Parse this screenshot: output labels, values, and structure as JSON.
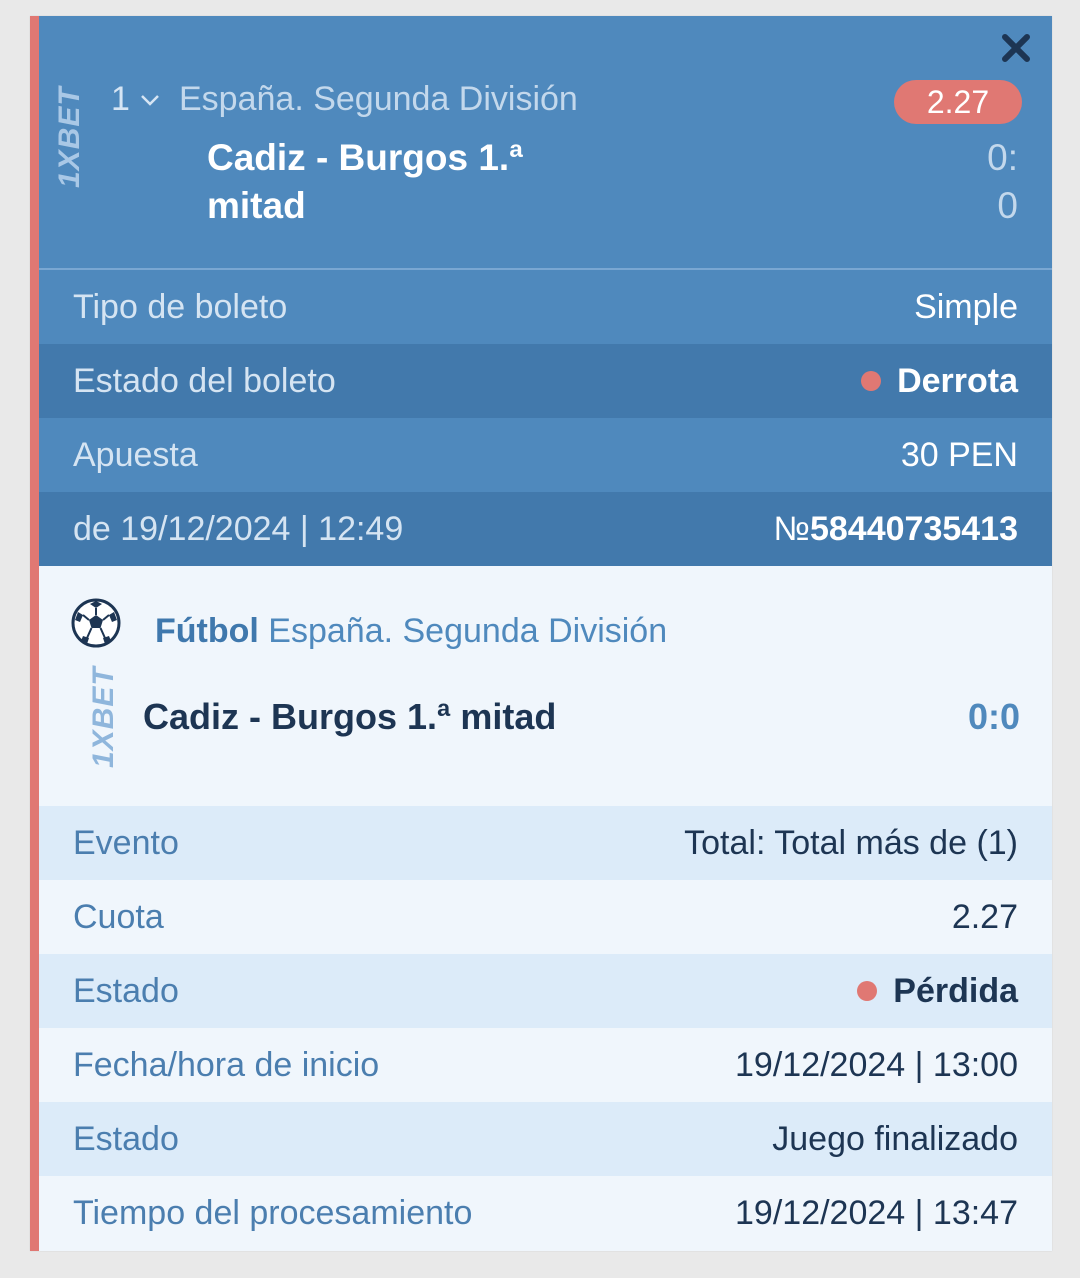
{
  "header": {
    "logo": "1XBET",
    "bet_number": "1",
    "league": "España. Segunda División",
    "match_line1": "Cadiz - Burgos 1.ª",
    "match_line2": "mitad",
    "odds": "2.27",
    "score_line1": "0:",
    "score_line2": "0",
    "close_icon": "close-icon"
  },
  "ticket": {
    "type_label": "Tipo de boleto",
    "type_value": "Simple",
    "status_label": "Estado del boleto",
    "status_value": "Derrota",
    "stake_label": "Apuesta",
    "stake_value": "30 PEN",
    "date_label": "de 19/12/2024 | 12:49",
    "number_prefix": "№",
    "number_value": "58440735413"
  },
  "event": {
    "sport": "Fútbol",
    "league": "España. Segunda División",
    "logo": "1XBET",
    "match": "Cadiz - Burgos 1.ª mitad",
    "score": "0:0"
  },
  "details": {
    "event_label": "Evento",
    "event_value": "Total: Total más de (1)",
    "odds_label": "Cuota",
    "odds_value": "2.27",
    "status_label": "Estado",
    "status_value": "Pérdida",
    "start_label": "Fecha/hora de inicio",
    "start_value": "19/12/2024 | 13:00",
    "state_label": "Estado",
    "state_value": "Juego finalizado",
    "processing_label": "Tiempo del procesamiento",
    "processing_value": "19/12/2024 | 13:47"
  },
  "colors": {
    "header_bg": "#4f89bd",
    "accent_red": "#e07873",
    "dark_text": "#1d3553"
  }
}
